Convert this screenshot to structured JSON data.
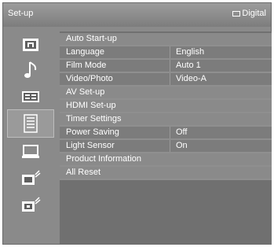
{
  "header": {
    "title": "Set-up",
    "source_label": "Digital",
    "source_icon": "monitor-icon"
  },
  "sidebar": {
    "items": [
      {
        "icon": "picture-icon",
        "selected": false
      },
      {
        "icon": "music-note-icon",
        "selected": false
      },
      {
        "icon": "screen-icon",
        "selected": false
      },
      {
        "icon": "setup-icon",
        "selected": true
      },
      {
        "icon": "pc-icon",
        "selected": false
      },
      {
        "icon": "network-icon",
        "selected": false
      },
      {
        "icon": "digital-network-icon",
        "selected": false
      }
    ]
  },
  "menu": {
    "items": [
      {
        "label": "Auto Start-up",
        "value": ""
      },
      {
        "label": "Language",
        "value": "English"
      },
      {
        "label": "Film Mode",
        "value": "Auto 1"
      },
      {
        "label": "Video/Photo",
        "value": "Video-A"
      },
      {
        "label": "AV Set-up",
        "value": ""
      },
      {
        "label": "HDMI Set-up",
        "value": ""
      },
      {
        "label": "Timer Settings",
        "value": ""
      },
      {
        "label": "Power Saving",
        "value": "Off"
      },
      {
        "label": "Light Sensor",
        "value": "On"
      },
      {
        "label": "Product Information",
        "value": ""
      },
      {
        "label": "All Reset",
        "value": ""
      }
    ]
  },
  "colors": {
    "background": "#8a8a8a",
    "row": "#7c7c7c",
    "text": "#ffffff"
  }
}
